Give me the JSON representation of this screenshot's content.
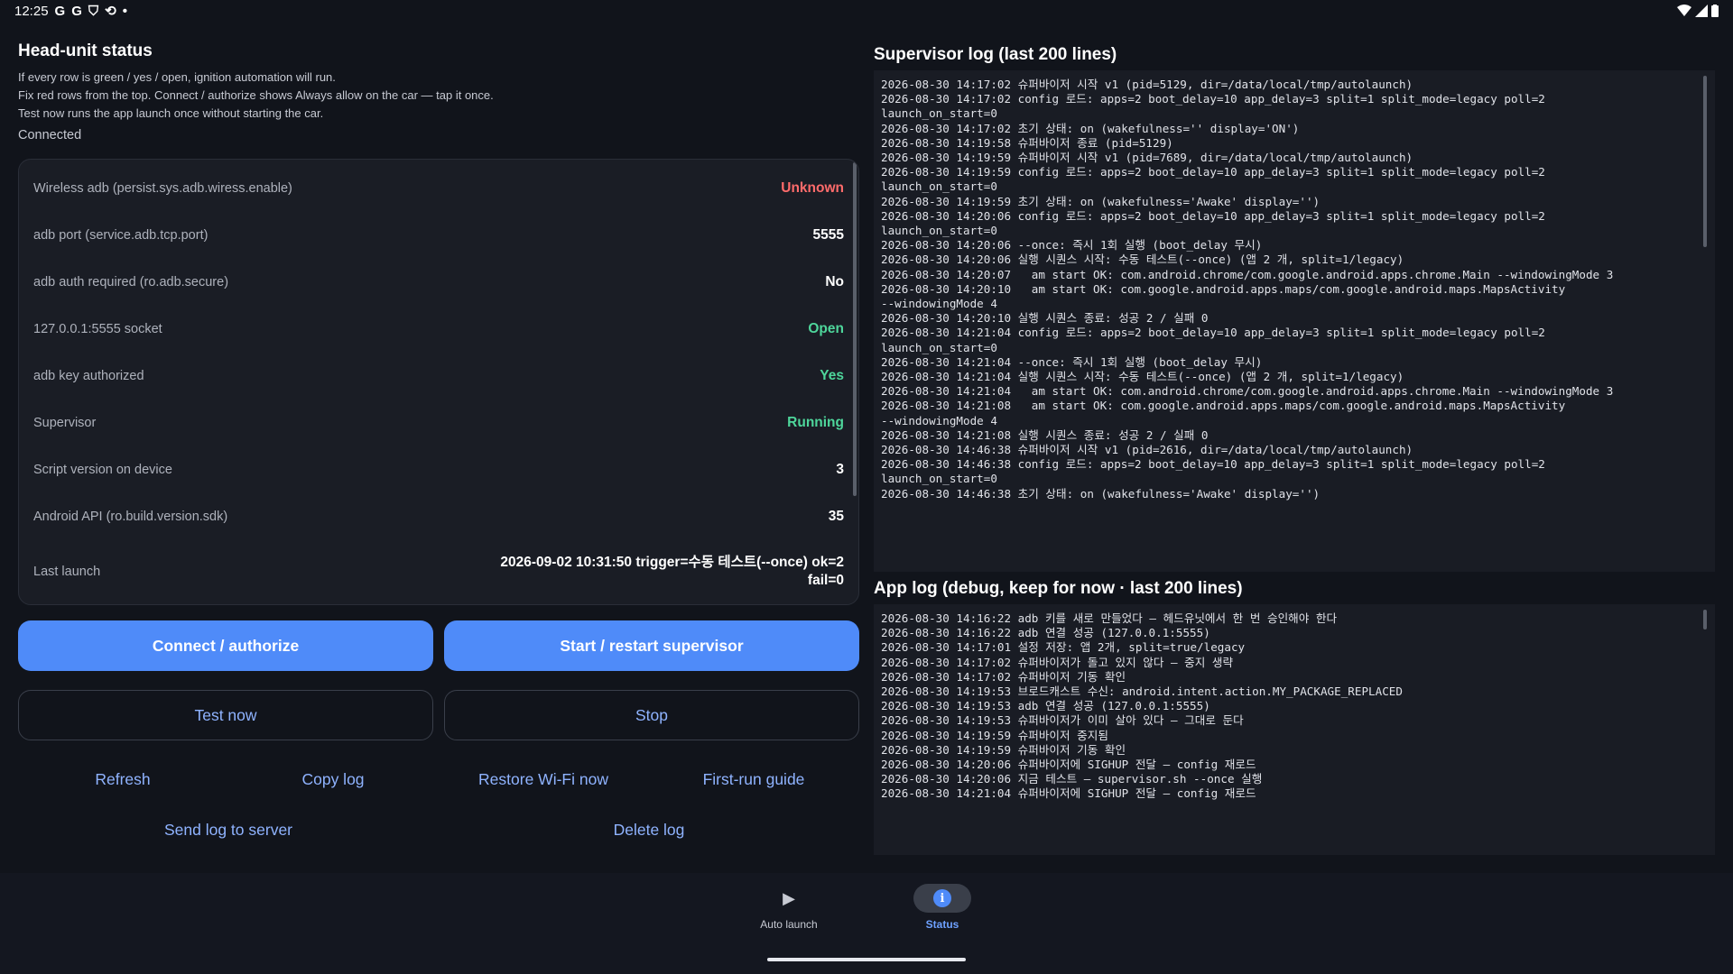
{
  "statusbar": {
    "time": "12:25",
    "icons_left": [
      "G",
      "G",
      "⛉",
      "⟲",
      "•"
    ]
  },
  "left": {
    "title": "Head-unit status",
    "desc_lines": [
      "If every row is green / yes / open, ignition automation will run.",
      "Fix red rows from the top. Connect / authorize shows Always allow on the car — tap it once.",
      "Test now runs the app launch once without starting the car."
    ],
    "connection_state": "Connected",
    "rows": [
      {
        "label": "Wireless adb (persist.sys.adb.wiress.enable)",
        "value": "Unknown",
        "status": "red"
      },
      {
        "label": "adb port (service.adb.tcp.port)",
        "value": "5555",
        "status": "white"
      },
      {
        "label": "adb auth required (ro.adb.secure)",
        "value": "No",
        "status": "white"
      },
      {
        "label": "127.0.0.1:5555 socket",
        "value": "Open",
        "status": "green"
      },
      {
        "label": "adb key authorized",
        "value": "Yes",
        "status": "green"
      },
      {
        "label": "Supervisor",
        "value": "Running",
        "status": "green"
      },
      {
        "label": "Script version on device",
        "value": "3",
        "status": "white"
      },
      {
        "label": "Android API (ro.build.version.sdk)",
        "value": "35",
        "status": "white"
      }
    ],
    "last_launch": {
      "label": "Last launch",
      "value_line1": "2026-09-02 10:31:50 trigger=수동 테스트(--once) ok=2",
      "value_line2": "fail=0"
    },
    "buttons": {
      "connect": "Connect / authorize",
      "start_supervisor": "Start / restart supervisor",
      "test_now": "Test now",
      "stop": "Stop",
      "refresh": "Refresh",
      "copy_log": "Copy log",
      "restore_wifi": "Restore Wi-Fi now",
      "first_run": "First-run guide",
      "send_log": "Send log to server",
      "delete_log": "Delete log"
    }
  },
  "supervisor_log": {
    "title": "Supervisor log (last 200 lines)",
    "lines": [
      "2026-08-30 14:17:02 슈퍼바이저 시작 v1 (pid=5129, dir=/data/local/tmp/autolaunch)",
      "2026-08-30 14:17:02 config 로드: apps=2 boot_delay=10 app_delay=3 split=1 split_mode=legacy poll=2",
      "launch_on_start=0",
      "2026-08-30 14:17:02 초기 상태: on (wakefulness='' display='ON')",
      "2026-08-30 14:19:58 슈퍼바이저 종료 (pid=5129)",
      "2026-08-30 14:19:59 슈퍼바이저 시작 v1 (pid=7689, dir=/data/local/tmp/autolaunch)",
      "2026-08-30 14:19:59 config 로드: apps=2 boot_delay=10 app_delay=3 split=1 split_mode=legacy poll=2",
      "launch_on_start=0",
      "2026-08-30 14:19:59 초기 상태: on (wakefulness='Awake' display='')",
      "2026-08-30 14:20:06 config 로드: apps=2 boot_delay=10 app_delay=3 split=1 split_mode=legacy poll=2",
      "launch_on_start=0",
      "2026-08-30 14:20:06 --once: 즉시 1회 실행 (boot_delay 무시)",
      "2026-08-30 14:20:06 실행 시퀀스 시작: 수동 테스트(--once) (앱 2 개, split=1/legacy)",
      "2026-08-30 14:20:07   am start OK: com.android.chrome/com.google.android.apps.chrome.Main --windowingMode 3",
      "2026-08-30 14:20:10   am start OK: com.google.android.apps.maps/com.google.android.maps.MapsActivity",
      "--windowingMode 4",
      "2026-08-30 14:20:10 실행 시퀀스 종료: 성공 2 / 실패 0",
      "2026-08-30 14:21:04 config 로드: apps=2 boot_delay=10 app_delay=3 split=1 split_mode=legacy poll=2",
      "launch_on_start=0",
      "2026-08-30 14:21:04 --once: 즉시 1회 실행 (boot_delay 무시)",
      "2026-08-30 14:21:04 실행 시퀀스 시작: 수동 테스트(--once) (앱 2 개, split=1/legacy)",
      "2026-08-30 14:21:04   am start OK: com.android.chrome/com.google.android.apps.chrome.Main --windowingMode 3",
      "2026-08-30 14:21:08   am start OK: com.google.android.apps.maps/com.google.android.maps.MapsActivity",
      "--windowingMode 4",
      "2026-08-30 14:21:08 실행 시퀀스 종료: 성공 2 / 실패 0",
      "2026-08-30 14:46:38 슈퍼바이저 시작 v1 (pid=2616, dir=/data/local/tmp/autolaunch)",
      "2026-08-30 14:46:38 config 로드: apps=2 boot_delay=10 app_delay=3 split=1 split_mode=legacy poll=2",
      "launch_on_start=0",
      "2026-08-30 14:46:38 초기 상태: on (wakefulness='Awake' display='')"
    ]
  },
  "app_log": {
    "title": "App log (debug, keep for now · last 200 lines)",
    "lines": [
      "2026-08-30 14:16:22 adb 키를 새로 만들었다 — 헤드유닛에서 한 번 승인해야 한다",
      "2026-08-30 14:16:22 adb 연결 성공 (127.0.0.1:5555)",
      "2026-08-30 14:17:01 설정 저장: 앱 2개, split=true/legacy",
      "2026-08-30 14:17:02 슈퍼바이저가 돌고 있지 않다 — 중지 생략",
      "2026-08-30 14:17:02 슈퍼바이저 기동 확인",
      "2026-08-30 14:19:53 브로드캐스트 수신: android.intent.action.MY_PACKAGE_REPLACED",
      "2026-08-30 14:19:53 adb 연결 성공 (127.0.0.1:5555)",
      "2026-08-30 14:19:53 슈퍼바이저가 이미 살아 있다 — 그대로 둔다",
      "2026-08-30 14:19:59 슈퍼바이저 중지됨",
      "2026-08-30 14:19:59 슈퍼바이저 기동 확인",
      "2026-08-30 14:20:06 슈퍼바이저에 SIGHUP 전달 — config 재로드",
      "2026-08-30 14:20:06 지금 테스트 — supervisor.sh --once 실행",
      "2026-08-30 14:21:04 슈퍼바이저에 SIGHUP 전달 — config 재로드"
    ]
  },
  "nav": {
    "items": [
      {
        "label": "Auto launch",
        "icon": "play-icon",
        "active": false
      },
      {
        "label": "Status",
        "icon": "info-icon",
        "active": true
      }
    ]
  },
  "colors": {
    "accent": "#4f8bf9",
    "green": "#4ed69b",
    "red": "#ff6b6b",
    "background": "#11141b"
  }
}
